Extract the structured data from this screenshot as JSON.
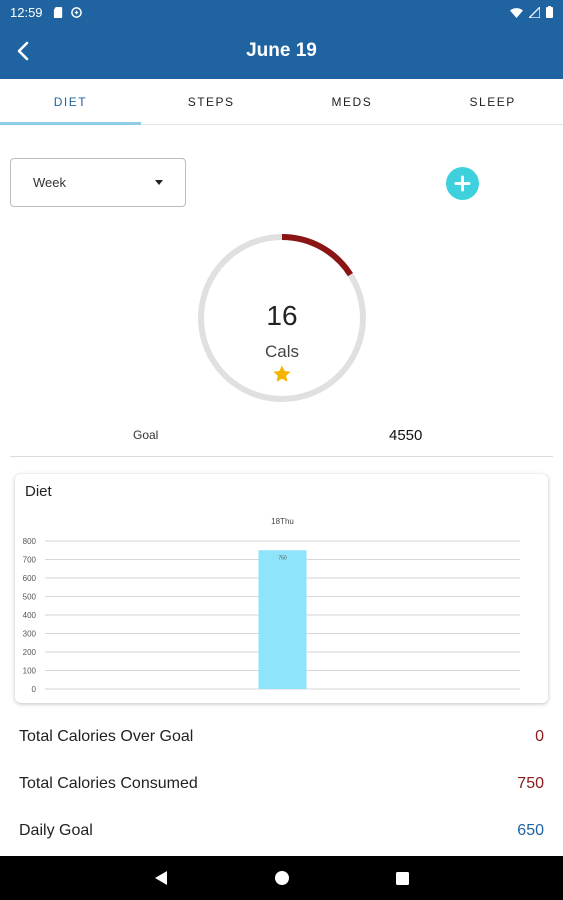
{
  "status_bar": {
    "time": "12:59",
    "left_icons": [
      "sd-card-icon",
      "sync-icon"
    ],
    "right_icons": [
      "wifi-icon",
      "signal-icon",
      "battery-icon"
    ]
  },
  "app_bar": {
    "title": "June 19",
    "back_icon": "chevron-left-icon"
  },
  "tabs": [
    {
      "label": "DIET",
      "active": true
    },
    {
      "label": "STEPS",
      "active": false
    },
    {
      "label": "MEDS",
      "active": false
    },
    {
      "label": "SLEEP",
      "active": false
    }
  ],
  "period_select": {
    "value": "Week"
  },
  "ring": {
    "value": "16",
    "unit": "Cals",
    "progress_fraction": 0.16,
    "progress_color": "#8b1414",
    "track_color": "#e0e0e0"
  },
  "goal": {
    "label": "Goal",
    "value": "4550"
  },
  "chart_card": {
    "title": "Diet"
  },
  "chart_data": {
    "type": "bar",
    "categories": [
      "18Thu"
    ],
    "values": [
      750
    ],
    "data_labels": [
      "750"
    ],
    "ylim": [
      0,
      800
    ],
    "yticks": [
      "800",
      "700",
      "600",
      "500",
      "400",
      "300",
      "200",
      "100",
      "0"
    ],
    "grid": true,
    "bar_color": "#8ee4fb"
  },
  "summary": [
    {
      "label": "Total Calories Over Goal",
      "value": "0",
      "color": "red"
    },
    {
      "label": "Total Calories Consumed",
      "value": "750",
      "color": "red"
    },
    {
      "label": "Daily Goal",
      "value": "650",
      "color": "blue"
    }
  ],
  "colors": {
    "primary": "#1f63a0",
    "accent": "#3ed0dc",
    "star": "#f4b400"
  }
}
